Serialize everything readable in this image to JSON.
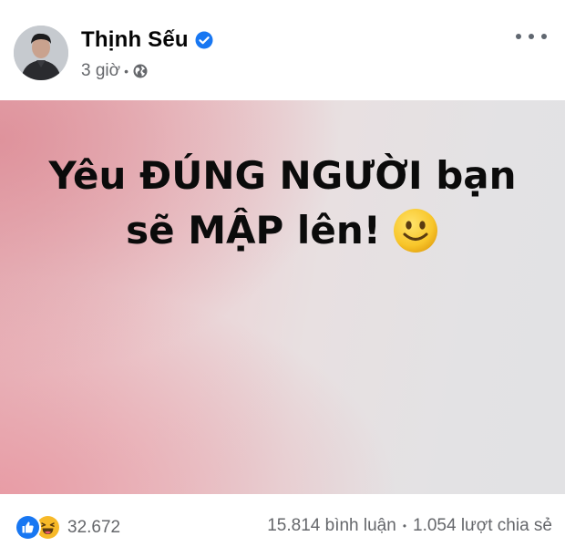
{
  "post": {
    "author": "Thịnh Sếu",
    "verified": true,
    "time": "3 giờ",
    "meta_separator": "•",
    "audience_icon": "globe-icon",
    "more_icon": "more-options-icon",
    "status_text": {
      "line1": "Yêu ĐÚNG NGƯỜI bạn",
      "line2": "sẽ MẬP lên!",
      "emoji": "slightly-smiling-face"
    },
    "reactions": {
      "icons": [
        "like-reaction-icon",
        "haha-reaction-icon"
      ],
      "count": "32.672"
    },
    "comments": "15.814 bình luận",
    "separator": "•",
    "shares": "1.054 lượt chia sẻ"
  },
  "colors": {
    "like_blue": "#1877f2",
    "verified_blue": "#1877f2",
    "haha_yellow": "#f7b928",
    "muted_text": "#65676b"
  }
}
